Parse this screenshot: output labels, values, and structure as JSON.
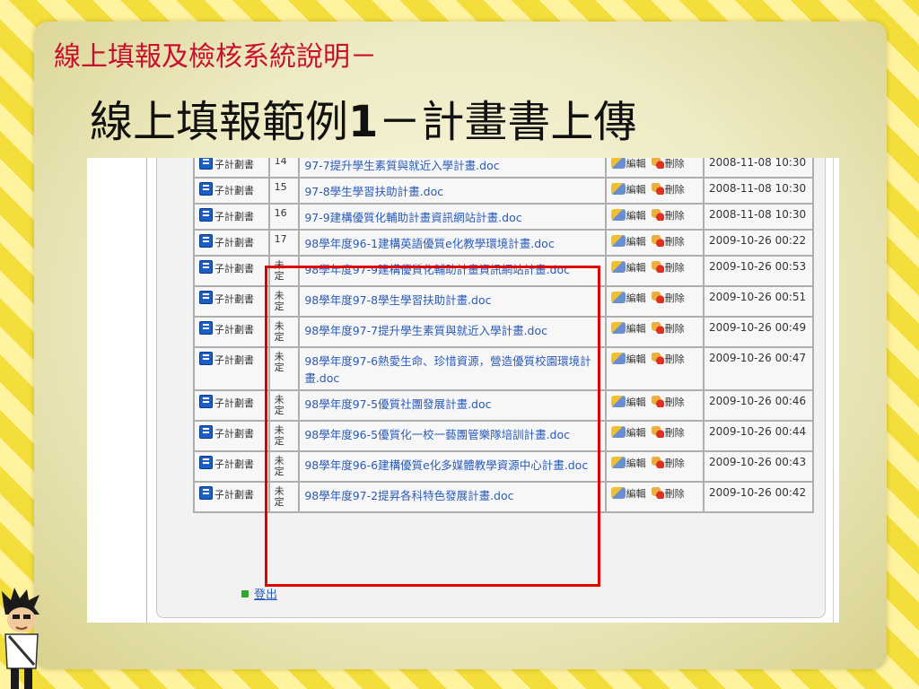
{
  "slide": {
    "subtitle": "線上填報及檢核系統說明－",
    "title_prefix": "線上填報範例",
    "title_num": "1",
    "title_suffix": "－計畫書上傳"
  },
  "labels": {
    "type": "子計劃書",
    "edit": "編輯",
    "delete": "刪除",
    "logout": "登出"
  },
  "rows": [
    {
      "num": "14",
      "file": "97-7提升學生素質與就近入學計畫.doc",
      "date": "2008-11-08 10:30"
    },
    {
      "num": "15",
      "file": "97-8學生學習扶助計畫.doc",
      "date": "2008-11-08 10:30"
    },
    {
      "num": "16",
      "file": "97-9建構優質化輔助計畫資訊網站計畫.doc",
      "date": "2008-11-08 10:30"
    },
    {
      "num": "17",
      "file": "98學年度96-1建構英語優質e化教學環境計畫.doc",
      "date": "2009-10-26 00:22"
    },
    {
      "num": "未定",
      "file": "98學年度97-9建構優質化輔助計畫資訊網站計畫.doc",
      "date": "2009-10-26 00:53"
    },
    {
      "num": "未定",
      "file": "98學年度97-8學生學習扶助計畫.doc",
      "date": "2009-10-26 00:51"
    },
    {
      "num": "未定",
      "file": "98學年度97-7提升學生素質與就近入學計畫.doc",
      "date": "2009-10-26 00:49"
    },
    {
      "num": "未定",
      "file": "98學年度97-6熱愛生命、珍惜資源，營造優質校園環境計畫.doc",
      "date": "2009-10-26 00:47"
    },
    {
      "num": "未定",
      "file": "98學年度97-5優質社團發展計畫.doc",
      "date": "2009-10-26 00:46"
    },
    {
      "num": "未定",
      "file": "98學年度96-5優質化一校一藝團管樂隊培訓計畫.doc",
      "date": "2009-10-26 00:44"
    },
    {
      "num": "未定",
      "file": "98學年度96-6建構優質e化多媒體教學資源中心計畫.doc",
      "date": "2009-10-26 00:43"
    },
    {
      "num": "未定",
      "file": "98學年度97-2提昇各科特色發展計畫.doc",
      "date": "2009-10-26 00:42"
    }
  ],
  "colors": {
    "subtitle": "#c8102e",
    "highlight": "#e00000",
    "link": "#2a5bb8"
  }
}
